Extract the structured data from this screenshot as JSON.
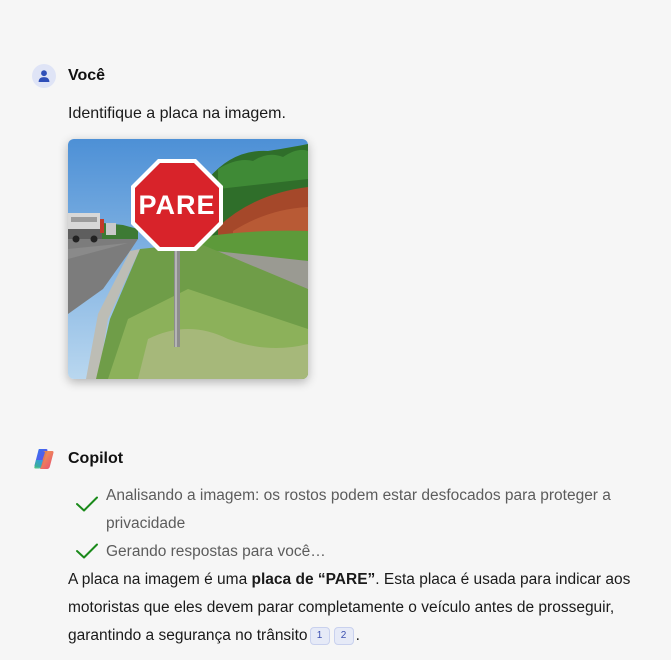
{
  "user_message": {
    "sender": "Você",
    "text": "Identifique a placa na imagem.",
    "image": {
      "alt": "PARE",
      "sign_text": "PARE"
    }
  },
  "bot_message": {
    "sender": "Copilot",
    "steps": [
      {
        "text": "Analisando a imagem: os rostos podem estar desfocados para proteger a privacidade",
        "status": "done"
      },
      {
        "text": "Gerando respostas para você…",
        "status": "done"
      }
    ],
    "answer": {
      "part1": "A placa na imagem é uma ",
      "bold": "placa de “PARE”",
      "part2": ". Esta placa é usada para indicar aos motoristas que eles devem parar completamente o veículo antes de prosseguir, garantindo a segurança no trânsito",
      "citations": [
        "1",
        "2"
      ],
      "end": "."
    }
  },
  "colors": {
    "check": "#1a8a1a",
    "user_avatar": "#2f4fb8",
    "sign_red": "#d8232a"
  }
}
